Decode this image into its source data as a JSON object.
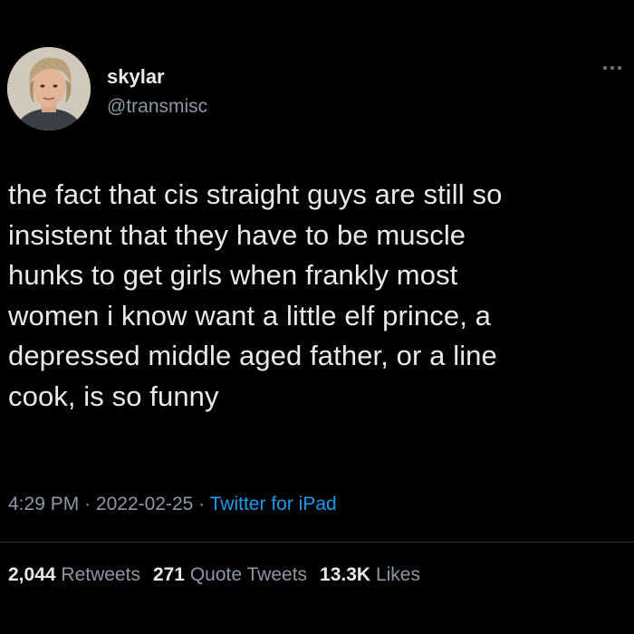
{
  "author": {
    "display_name": "skylar",
    "handle": "@transmisc"
  },
  "more_icon": "more-horizontal-icon",
  "tweet": {
    "text": "the fact that cis straight guys are still so\ninsistent that they have to be muscle\nhunks to get girls when frankly most\nwomen i know want a little elf prince, a\ndepressed middle aged father, or a line\ncook, is so funny"
  },
  "meta": {
    "time": "4:29 PM",
    "separator": "·",
    "date": "2022-02-25",
    "source": "Twitter for iPad"
  },
  "stats": {
    "retweets_count": "2,044",
    "retweets_label": "Retweets",
    "quote_count": "271",
    "quote_label": "Quote Tweets",
    "likes_count": "13.3K",
    "likes_label": "Likes"
  },
  "colors": {
    "background": "#000000",
    "primary_text": "#e7e9ea",
    "secondary_text": "#8b98a5",
    "link": "#1d9bf0"
  }
}
